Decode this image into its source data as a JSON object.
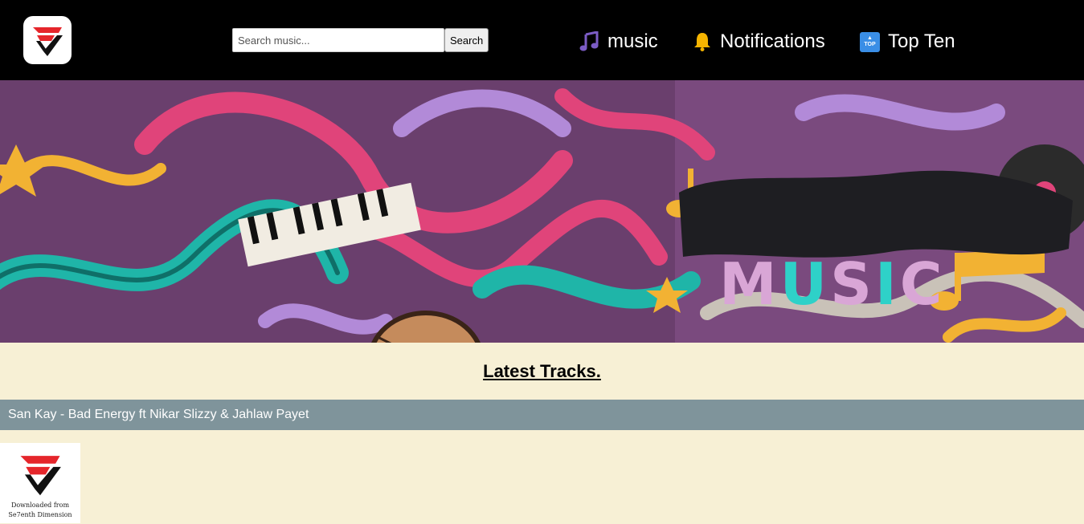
{
  "header": {
    "logo_name": "Se7enth Dimension logo",
    "search": {
      "placeholder": "Search music...",
      "value": "",
      "button_label": "Search"
    },
    "nav": [
      {
        "icon": "music-note-icon",
        "label": "music"
      },
      {
        "icon": "bell-icon",
        "label": "Notifications"
      },
      {
        "icon": "top-icon",
        "label": "Top Ten",
        "icon_text": "TOP"
      }
    ]
  },
  "banner": {
    "title": "MUSIC"
  },
  "main": {
    "heading": "Latest Tracks.",
    "tracks": [
      {
        "title": "San Kay - Bad Energy ft Nikar Slizzy & Jahlaw Payet",
        "cover_caption_line1": "Downloaded from",
        "cover_caption_line2": "Se7enth Dimension"
      }
    ]
  },
  "colors": {
    "header_bg": "#000000",
    "page_bg": "#f7f0d5",
    "track_bar_bg": "#7f949b",
    "logo_red": "#e5262b"
  }
}
